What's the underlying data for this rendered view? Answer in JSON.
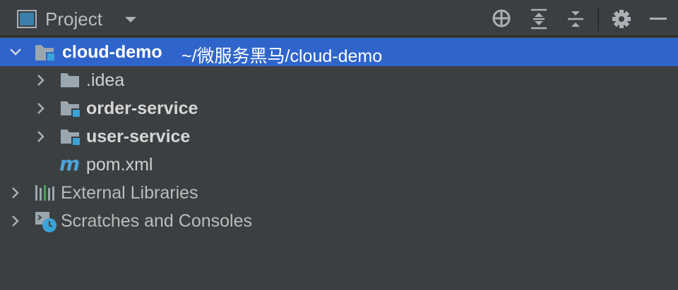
{
  "header": {
    "title": "Project",
    "icons": [
      "panel-icon",
      "dropdown-icon",
      "locate-icon",
      "expand-all-icon",
      "collapse-all-icon",
      "gear-icon",
      "minimize-icon"
    ]
  },
  "tree": {
    "root": {
      "name": "cloud-demo",
      "path": "~/微服务黑马/cloud-demo"
    },
    "children": [
      {
        "name": ".idea"
      },
      {
        "name": "order-service"
      },
      {
        "name": "user-service"
      },
      {
        "name": "pom.xml"
      }
    ],
    "external_libraries": "External Libraries",
    "scratches": "Scratches and Consoles"
  },
  "colors": {
    "background": "#3c3f41",
    "selection": "#2f65ca",
    "module_badge": "#3aa3d8"
  }
}
